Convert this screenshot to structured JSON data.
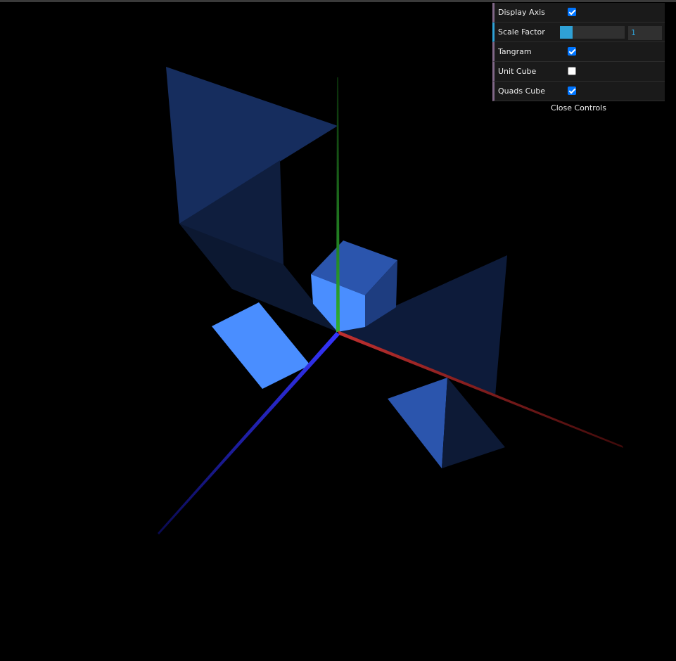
{
  "controls": {
    "display_axis": {
      "label": "Display Axis",
      "checked": true
    },
    "scale_factor": {
      "label": "Scale Factor",
      "value": "1",
      "fill_fraction": 0.2
    },
    "tangram": {
      "label": "Tangram",
      "checked": true
    },
    "unit_cube": {
      "label": "Unit Cube",
      "checked": false
    },
    "quads_cube": {
      "label": "Quads Cube",
      "checked": true
    },
    "close_label": "Close Controls"
  },
  "colors": {
    "background": "#000000",
    "x_axis": "#c03030",
    "y_axis": "#30b030",
    "z_axis": "#3535ff",
    "shape_light": "#4a8eff",
    "shape_mid": "#2b55ad",
    "shape_dark": "#0d1a36",
    "gui_accent": "#2fa1d6"
  }
}
